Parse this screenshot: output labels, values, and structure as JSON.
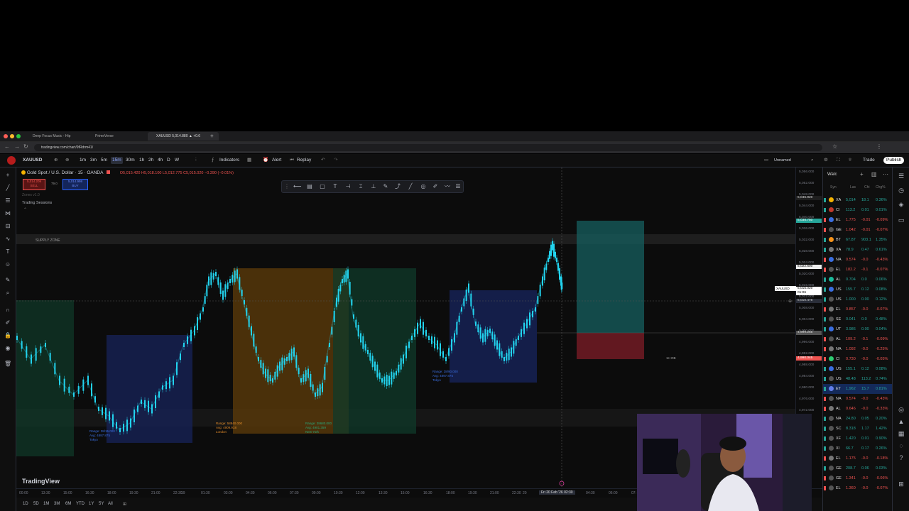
{
  "browser": {
    "tabs": [
      {
        "title": "Deep Focus Music - Hip"
      },
      {
        "title": "PrimeVerse"
      },
      {
        "title": "XAUUSD 5,014.880 ▲ +0.6"
      }
    ],
    "url": "tradingview.com/chart/9fRdrm41/"
  },
  "toolbar": {
    "symbol": "XAUUSD",
    "intervals": [
      "1m",
      "3m",
      "5m",
      "15m",
      "30m",
      "1h",
      "2h",
      "4h",
      "D",
      "W"
    ],
    "active_interval": "15m",
    "indicators_label": "Indicators",
    "alert_label": "Alert",
    "replay_label": "Replay",
    "layout_name": "Unnamed",
    "trade_label": "Trade",
    "publish_label": "Publish"
  },
  "legend": {
    "title": "Gold Spot / U.S. Dollar · 15 · OANDA",
    "ohlc": "O5,015.420 H5,018.100 L5,012.775 C5,015.020 −0.390 (−0.01%)",
    "sell_price": "5,014.209",
    "sell_label": "SELL",
    "spread": "79.0",
    "buy_price": "5,014.998",
    "buy_label": "BUY",
    "indicator_zones": "Zones v1.0",
    "indicator_sessions": "Trading Sessions"
  },
  "chart_annotations": {
    "supply_zone": "SUPPLY ZONE",
    "ob_label": "1H OB",
    "sessions": [
      {
        "range": "Range: 38/15.000",
        "avg": "Avg: 4897.875",
        "name": "Tokyo"
      },
      {
        "range": "Range: 58840.000",
        "avg": "Avg: 4909.918",
        "name": "London"
      },
      {
        "range": "Range: 38680.000",
        "avg": "Avg: 4901.359",
        "name": "New York"
      },
      {
        "range": "Range: 38/90.000",
        "avg": "Avg: 4897.875",
        "name": "Tokyo"
      }
    ],
    "watermark": "TradingView"
  },
  "price_axis": {
    "labels": [
      "5,056.000",
      "5,052.000",
      "5,048.000",
      "5,044.000",
      "5,040.000",
      "5,036.000",
      "5,032.000",
      "5,028.000",
      "5,024.000",
      "5,020.000",
      "5,016.000",
      "5,012.000",
      "5,008.000",
      "5,004.000",
      "5,000.000",
      "4,996.000",
      "4,992.000",
      "4,988.000",
      "4,984.000",
      "4,980.000",
      "4,976.000",
      "4,972.000"
    ],
    "tag_tp": "5,046.920",
    "tag_target": "5,038.750",
    "tag_mid": "5,022.600",
    "tag_symbol": "XAUUSD",
    "tag_last": "5,015.020",
    "tag_countdown": "01:06",
    "tag_cross": "5,010.478",
    "tag_entry": "4,999.265",
    "tag_sl": "4,990.045"
  },
  "time_axis": {
    "labels": [
      "00:00",
      "13:30",
      "15:00",
      "16:30",
      "18:00",
      "19:30",
      "21:00",
      "22:30",
      "19",
      "01:30",
      "03:00",
      "04:30",
      "06:00",
      "07:30",
      "09:00",
      "10:30",
      "12:00",
      "13:30",
      "15:00",
      "16:30",
      "18:00",
      "19:30",
      "21:00",
      "22:30",
      "20",
      "02:30",
      "04:30",
      "06:00",
      "07:"
    ],
    "cursor_time": "Fri 20 Feb '26  02:30"
  },
  "bottom_ranges": [
    "1D",
    "5D",
    "1M",
    "3M",
    "6M",
    "YTD",
    "1Y",
    "5Y",
    "All"
  ],
  "watchlist": {
    "title": "Watc",
    "columns": [
      "Syn",
      "Las",
      "Chi",
      "Chg%"
    ],
    "rows": [
      {
        "sym": "XA",
        "last": "5,014",
        "chg": "18.1",
        "pct": "0.36%",
        "dir": "up"
      },
      {
        "sym": "CI",
        "last": "113.2",
        "chg": "0.01",
        "pct": "0.01%",
        "dir": "up"
      },
      {
        "sym": "EL",
        "last": "1.775",
        "chg": "-0.01",
        "pct": "-0.09%",
        "dir": "down"
      },
      {
        "sym": "GE",
        "last": "1.042",
        "chg": "-0.01",
        "pct": "-0.07%",
        "dir": "down"
      },
      {
        "sym": "BT",
        "last": "67.87",
        "chg": "903.1",
        "pct": "1.35%",
        "dir": "up"
      },
      {
        "sym": "XA",
        "last": "78.9",
        "chg": "0.47",
        "pct": "0.61%",
        "dir": "up"
      },
      {
        "sym": "NA",
        "last": "0.574",
        "chg": "-0.0",
        "pct": "-0.43%",
        "dir": "down"
      },
      {
        "sym": "EL",
        "last": "182.2",
        "chg": "-0.1",
        "pct": "-0.07%",
        "dir": "down"
      },
      {
        "sym": "AL",
        "last": "0.704",
        "chg": "0.0",
        "pct": "0.06%",
        "dir": "up"
      },
      {
        "sym": "US",
        "last": "155.7",
        "chg": "0.12",
        "pct": "0.08%",
        "dir": "up"
      },
      {
        "sym": "US",
        "last": "1.000",
        "chg": "0.00",
        "pct": "0.12%",
        "dir": "up"
      },
      {
        "sym": "EL",
        "last": "0.857",
        "chg": "-0.0",
        "pct": "-0.07%",
        "dir": "down"
      },
      {
        "sym": "SE",
        "last": "0.041",
        "chg": "0.0",
        "pct": "0.48%",
        "dir": "up"
      },
      {
        "sym": "UT",
        "last": "3.986",
        "chg": "0.00",
        "pct": "0.04%",
        "dir": "up"
      },
      {
        "sym": "AL",
        "last": "109.2",
        "chg": "-0.1",
        "pct": "-0.09%",
        "dir": "down"
      },
      {
        "sym": "NA",
        "last": "1.092",
        "chg": "-0.0",
        "pct": "-0.25%",
        "dir": "down"
      },
      {
        "sym": "CI",
        "last": "0.730",
        "chg": "-0.0",
        "pct": "-0.05%",
        "dir": "down"
      },
      {
        "sym": "US",
        "last": "155.1",
        "chg": "0.12",
        "pct": "0.08%",
        "dir": "up"
      },
      {
        "sym": "US",
        "last": "48.48",
        "chg": "113.2",
        "pct": "0.74%",
        "dir": "up"
      },
      {
        "sym": "ET",
        "last": "1,962",
        "chg": "15.7",
        "pct": "0.81%",
        "dir": "up"
      },
      {
        "sym": "NA",
        "last": "0.574",
        "chg": "-0.0",
        "pct": "-0.43%",
        "dir": "down"
      },
      {
        "sym": "AL",
        "last": "0.646",
        "chg": "-0.0",
        "pct": "-0.33%",
        "dir": "down"
      },
      {
        "sym": "NA",
        "last": "24.80",
        "chg": "0.05",
        "pct": "0.20%",
        "dir": "up"
      },
      {
        "sym": "SC",
        "last": "8.318",
        "chg": "1.17",
        "pct": "1.42%",
        "dir": "up"
      },
      {
        "sym": "XF",
        "last": "1.420",
        "chg": "0.01",
        "pct": "0.90%",
        "dir": "up"
      },
      {
        "sym": "XI",
        "last": "66.7",
        "chg": "0.17",
        "pct": "0.26%",
        "dir": "up"
      },
      {
        "sym": "EL",
        "last": "1.175",
        "chg": "-0.0",
        "pct": "-0.18%",
        "dir": "down"
      },
      {
        "sym": "GE",
        "last": "208.7",
        "chg": "0.06",
        "pct": "0.03%",
        "dir": "up"
      },
      {
        "sym": "GE",
        "last": "1.341",
        "chg": "-0.0",
        "pct": "-0.06%",
        "dir": "down"
      },
      {
        "sym": "EL",
        "last": "1.360",
        "chg": "-0.0",
        "pct": "-0.07%",
        "dir": "down"
      }
    ]
  },
  "colors": {
    "up": "#26a69a",
    "down": "#ef5350",
    "candle": "#22d3ee",
    "accent": "#2962ff"
  }
}
